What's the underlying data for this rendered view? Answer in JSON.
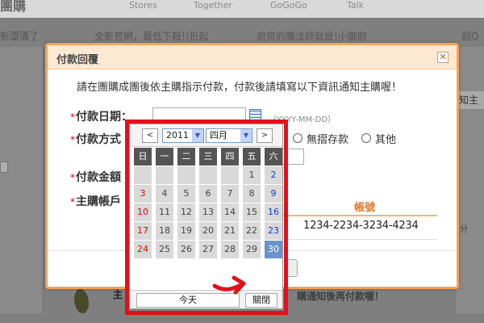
{
  "background": {
    "logo_text": "團購",
    "nav": [
      "Stores",
      "Together",
      "GoGoGo",
      "Talk"
    ],
    "promos": [
      "新澀價了",
      "全新官網，最低下殺!!折起",
      "廚房的魔法師就是!小御廚",
      "超Q"
    ],
    "right_tag": "知主",
    "right_sub": "分",
    "bottom_text": "購通知後再付款喔！",
    "bottom_fragment": "主"
  },
  "modal": {
    "title": "付款回覆",
    "close_icon": "✕",
    "intro": "請在團購成團後依主購指示付款，付款後請填寫以下資訊通知主購喔！",
    "required_mark": "*",
    "payment_date_label": "付款日期：",
    "date_input_value": "",
    "date_hint": "（YYYY-MM-DD）",
    "payment_method_label": "付款方式",
    "payment_methods": [
      "無摺存款",
      "其他"
    ],
    "amount_label": "付款金額",
    "account_label": "主購帳戶",
    "account_header": "帳號",
    "account_number": "1234-2234-3234-4234"
  },
  "datepicker": {
    "prev_label": "<",
    "next_label": ">",
    "year": "2011",
    "month": "四月",
    "weekdays": [
      "日",
      "一",
      "二",
      "三",
      "四",
      "五",
      "六"
    ],
    "weeks": [
      [
        "",
        "",
        "",
        "",
        "",
        "1",
        "2"
      ],
      [
        "3",
        "4",
        "5",
        "6",
        "7",
        "8",
        "9"
      ],
      [
        "10",
        "11",
        "12",
        "13",
        "14",
        "15",
        "16"
      ],
      [
        "17",
        "18",
        "19",
        "20",
        "21",
        "22",
        "23"
      ],
      [
        "24",
        "25",
        "26",
        "27",
        "28",
        "29",
        "30"
      ]
    ],
    "selected_day": "30",
    "today_label": "今天",
    "close_label": "關閉"
  },
  "colors": {
    "accent_orange": "#f4a259",
    "highlight_red": "#e3101b",
    "selected_blue": "#6a94c9"
  }
}
